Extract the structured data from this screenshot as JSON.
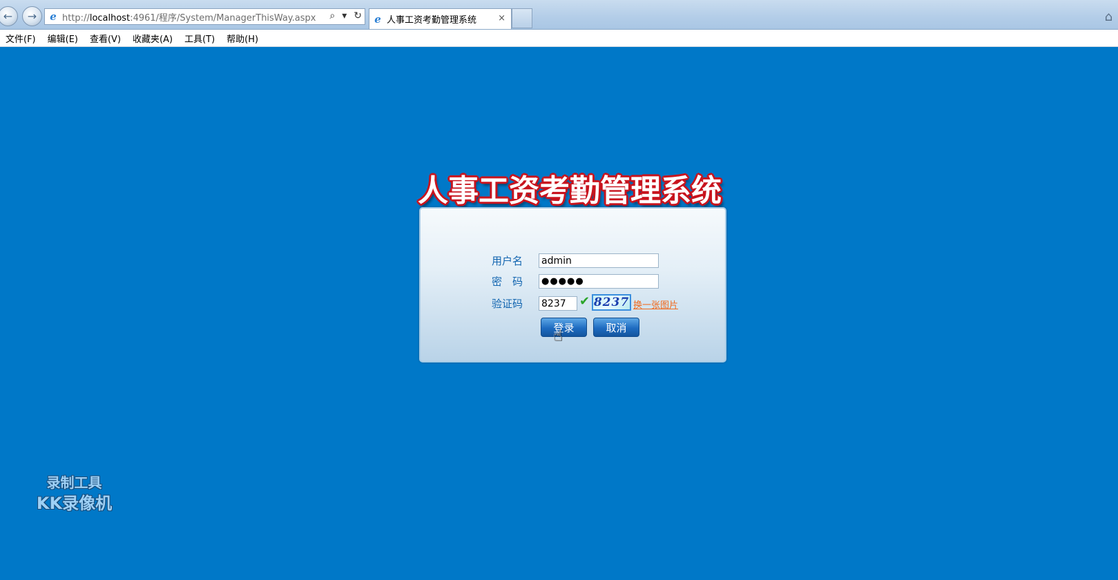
{
  "browser": {
    "url": "http://localhost:4961/程序/System/ManagerThisWay.aspx",
    "url_prefix": "http://",
    "url_host": "localhost",
    "url_rest": ":4961/程序/System/ManagerThisWay.aspx",
    "tab_title": "人事工资考勤管理系统",
    "tab_close": "×",
    "menu": [
      "文件(F)",
      "编辑(E)",
      "查看(V)",
      "收藏夹(A)",
      "工具(T)",
      "帮助(H)"
    ]
  },
  "page": {
    "title": "人事工资考勤管理系统",
    "labels": {
      "username": "用户名",
      "password": "密　码",
      "captcha": "验证码"
    },
    "values": {
      "username": "admin",
      "password": "●●●●●",
      "captcha": "8237"
    },
    "captcha_image_text": "8237",
    "captcha_refresh": "换一张图片",
    "buttons": {
      "login": "登录",
      "cancel": "取消"
    }
  },
  "watermark": {
    "line1": "录制工具",
    "line2": "KK录像机"
  },
  "colors": {
    "page_background": "#0078c8",
    "title_outline": "#c8141e",
    "label": "#1366b0",
    "link": "#f06a1e"
  }
}
